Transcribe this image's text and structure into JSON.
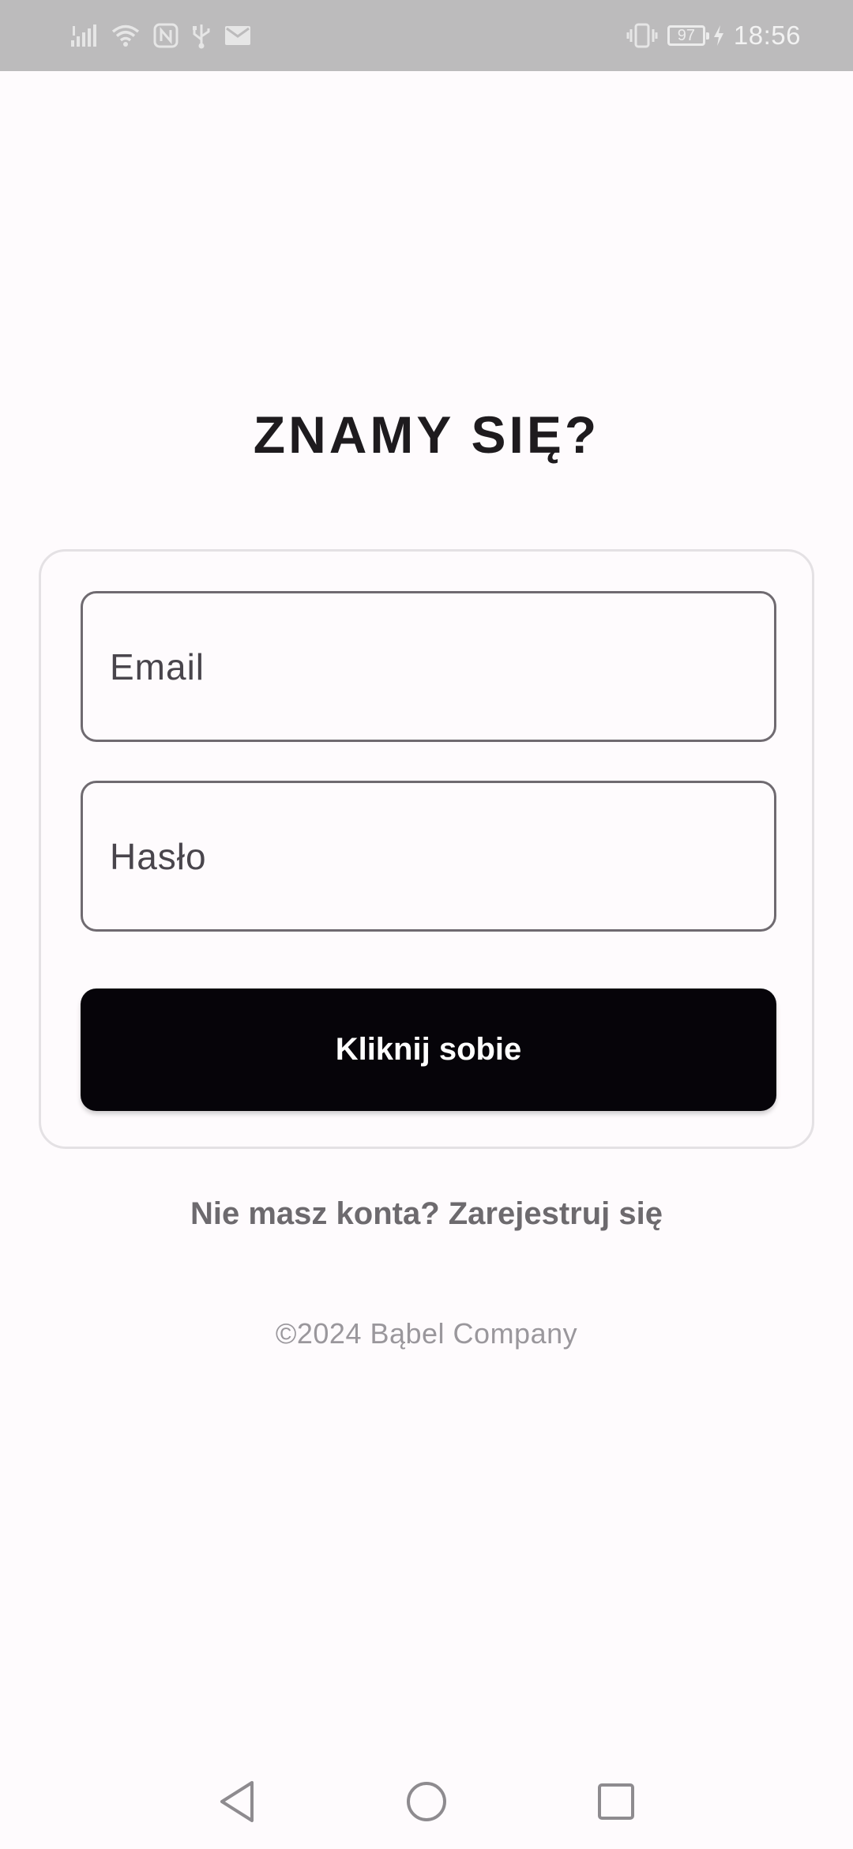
{
  "status_bar": {
    "time": "18:56",
    "battery_level": "97",
    "icons": [
      "signal-icon",
      "wifi-icon",
      "nfc-icon",
      "usb-icon",
      "mail-icon",
      "vibrate-icon",
      "battery-icon",
      "charging-icon"
    ]
  },
  "page": {
    "title": "ZNAMY SIĘ?"
  },
  "login_form": {
    "email_placeholder": "Email",
    "password_placeholder": "Hasło",
    "submit_label": "Kliknij sobie"
  },
  "register_link": "Nie masz konta? Zarejestruj się",
  "footer": {
    "copyright": "©2024 Bąbel Company"
  },
  "nav_bar": {
    "icons": [
      "back-icon",
      "home-icon",
      "recents-icon"
    ]
  },
  "colors": {
    "background": "#fefbfd",
    "status_bar": "#bcbbbc",
    "button": "#060409",
    "field_border": "#6f6a70",
    "card_border": "#e4e1e4",
    "link": "#6d6a6e"
  }
}
